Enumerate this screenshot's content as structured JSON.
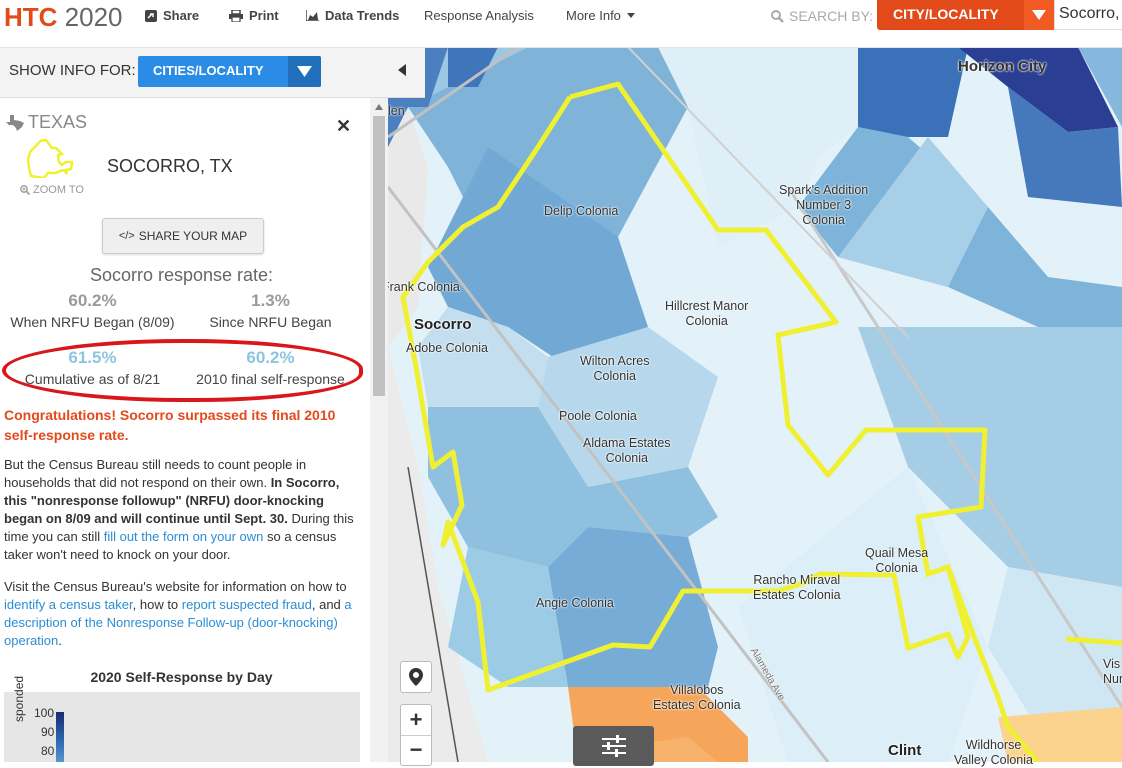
{
  "header": {
    "brand_main": "HTC",
    "brand_year": "2020",
    "nav": {
      "share": "Share",
      "print": "Print",
      "data_trends": "Data Trends",
      "response_analysis": "Response Analysis",
      "more_info": "More Info"
    },
    "search_by_label": "SEARCH BY:",
    "search_by_value": "CITY/LOCALITY",
    "search_value": "Socorro,"
  },
  "show_info": {
    "label": "SHOW INFO FOR:",
    "value": "CITIES/LOCALITY"
  },
  "panel": {
    "state": "TEXAS",
    "place": "SOCORRO, TX",
    "zoom_to": "ZOOM TO",
    "share_map": "SHARE YOUR MAP",
    "response_heading": "Socorro response rate:",
    "stats": [
      {
        "value": "60.2%",
        "label": "When NRFU Began (8/09)"
      },
      {
        "value": "1.3%",
        "label": "Since NRFU Began"
      },
      {
        "value": "61.5%",
        "label": "Cumulative as of 8/21"
      },
      {
        "value": "60.2%",
        "label": "2010 final self-response"
      }
    ],
    "congrats": "Congratulations! Socorro surpassed its final 2010 self-response rate.",
    "para1": {
      "t1": "But the Census Bureau still needs to count people in households that did not respond on their own. ",
      "b1": "In Socorro, this \"nonresponse followup\" (NRFU) door-knocking began on 8/09 and will continue until Sept. 30.",
      "t2": " During this time you can still ",
      "link1": "fill out the form on your own",
      "t3": " so a census taker won't need to knock on your door."
    },
    "para2": {
      "t1": "Visit the Census Bureau's website for information on how to ",
      "link1": "identify a census taker",
      "t2": ", how to ",
      "link2": "report suspected fraud",
      "t3": ", and ",
      "link3": "a description of the Nonresponse Follow-up (door-knocking) operation",
      "t4": "."
    },
    "chart_title": "2020 Self-Response by Day",
    "chart_ylabel": "sponded",
    "chart_yticks": [
      "100",
      "90",
      "80"
    ]
  },
  "map": {
    "labels": {
      "horizon_city": "Horizon City",
      "spark1": "Spark's Addition",
      "spark2": "Number 3",
      "spark3": "Colonia",
      "delip": "Delip Colonia",
      "frank": "Frank Colonia",
      "hill1": "Hillcrest Manor",
      "hill2": "Colonia",
      "socorro": "Socorro",
      "adobe": "Adobe Colonia",
      "wilton1": "Wilton Acres",
      "wilton2": "Colonia",
      "poole": "Poole Colonia",
      "aldama1": "Aldama Estates",
      "aldama2": "Colonia",
      "quail1": "Quail Mesa",
      "quail2": "Colonia",
      "rancho1": "Rancho Miraval",
      "rancho2": "Estates Colonia",
      "angie": "Angie Colonia",
      "villa1": "Villalobos",
      "villa2": "Estates Colonia",
      "clint": "Clint",
      "wild1": "Wildhorse",
      "wild2": "Valley Colonia",
      "vis1": "Vis",
      "vis2": "Numb",
      "len": "len",
      "road": "Alameda Ave"
    }
  },
  "colors": {
    "accent": "#e34a1a",
    "select_blue": "#2b8ce6",
    "boundary": "#f0f032",
    "annotation_red": "#d9161a"
  }
}
